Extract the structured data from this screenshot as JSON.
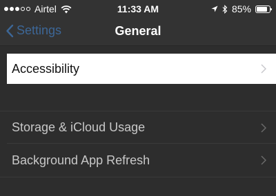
{
  "status_bar": {
    "carrier": "Airtel",
    "time": "11:33 AM",
    "battery": "85%",
    "battery_level": 0.85,
    "icons": [
      "signal-dots-icon",
      "wifi-icon",
      "location-arrow-icon",
      "bluetooth-icon",
      "battery-icon"
    ]
  },
  "nav": {
    "back_label": "Settings",
    "title": "General"
  },
  "rows": [
    {
      "label": "Accessibility",
      "highlighted": true
    },
    {
      "label": "Storage & iCloud Usage",
      "highlighted": false
    },
    {
      "label": "Background App Refresh",
      "highlighted": false
    }
  ],
  "colors": {
    "background": "#2d2d2d",
    "nav_background": "#333333",
    "accent": "#3d6797",
    "highlight_row": "#ffffff",
    "dim_text": "#c8c8c8",
    "chevron": "#6b6b6b"
  }
}
